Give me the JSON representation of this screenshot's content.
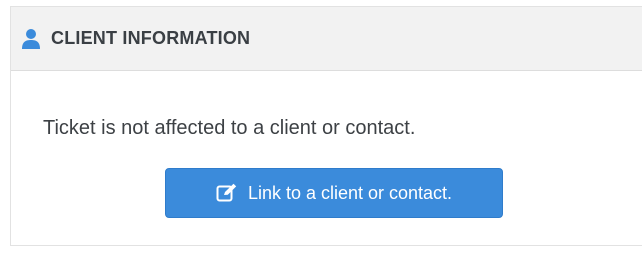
{
  "panel": {
    "icon": "user-icon",
    "title": "CLIENT INFORMATION",
    "message": "Ticket is not affected to a client or contact.",
    "link_button": {
      "icon": "edit-icon",
      "label": "Link to a client or contact."
    }
  },
  "colors": {
    "accent": "#3b8bdb",
    "header_bg": "#f2f2f2",
    "text": "#3d4145"
  }
}
